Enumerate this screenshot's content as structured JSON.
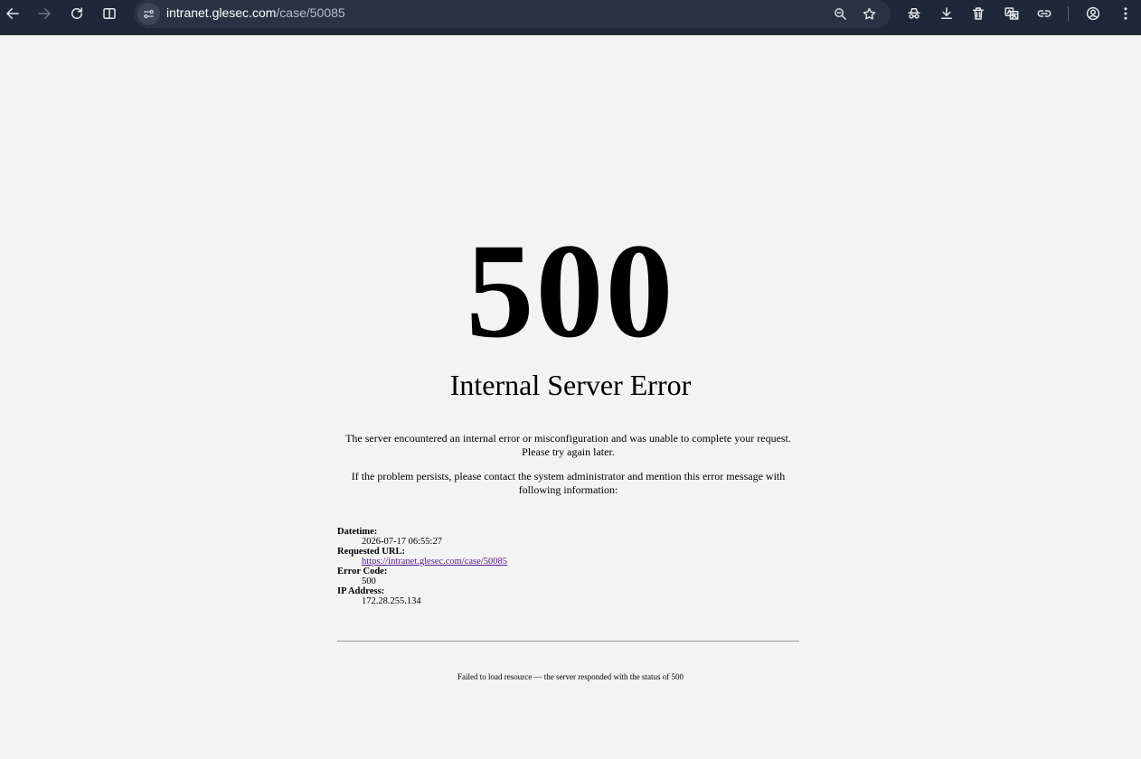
{
  "browser": {
    "url_host": "intranet.glesec.com",
    "url_path": "/case/50085",
    "icons": [
      "back-icon",
      "forward-icon",
      "reload-icon",
      "split-view-icon",
      "site-info-icon",
      "zoom-icon",
      "bookmark-star-icon",
      "incognito-icon",
      "download-icon",
      "delete-icon",
      "translate-icon",
      "link-icon",
      "profile-icon",
      "menu-icon"
    ]
  },
  "error": {
    "code": "500",
    "title": "Internal Server Error",
    "message1_line1": "The server encountered an internal error or misconfiguration and was unable to complete your request.",
    "message1_line2": "Please try again later.",
    "message2_line1": "If the problem persists, please contact the system administrator and mention this error message with",
    "message2_line2": "following information:"
  },
  "details": {
    "datetime_label": "Datetime:",
    "datetime_value": "2026-07-17 06:55:27",
    "url_label": "Requested URL:",
    "url_value": "https://intranet.glesec.com/case/50085",
    "code_label": "Error Code:",
    "code_value": "500",
    "ip_label": "IP Address:",
    "ip_value": "172.28.255.134"
  },
  "footer": {
    "text": "Failed to load resource — the server responded with the status of 500"
  }
}
